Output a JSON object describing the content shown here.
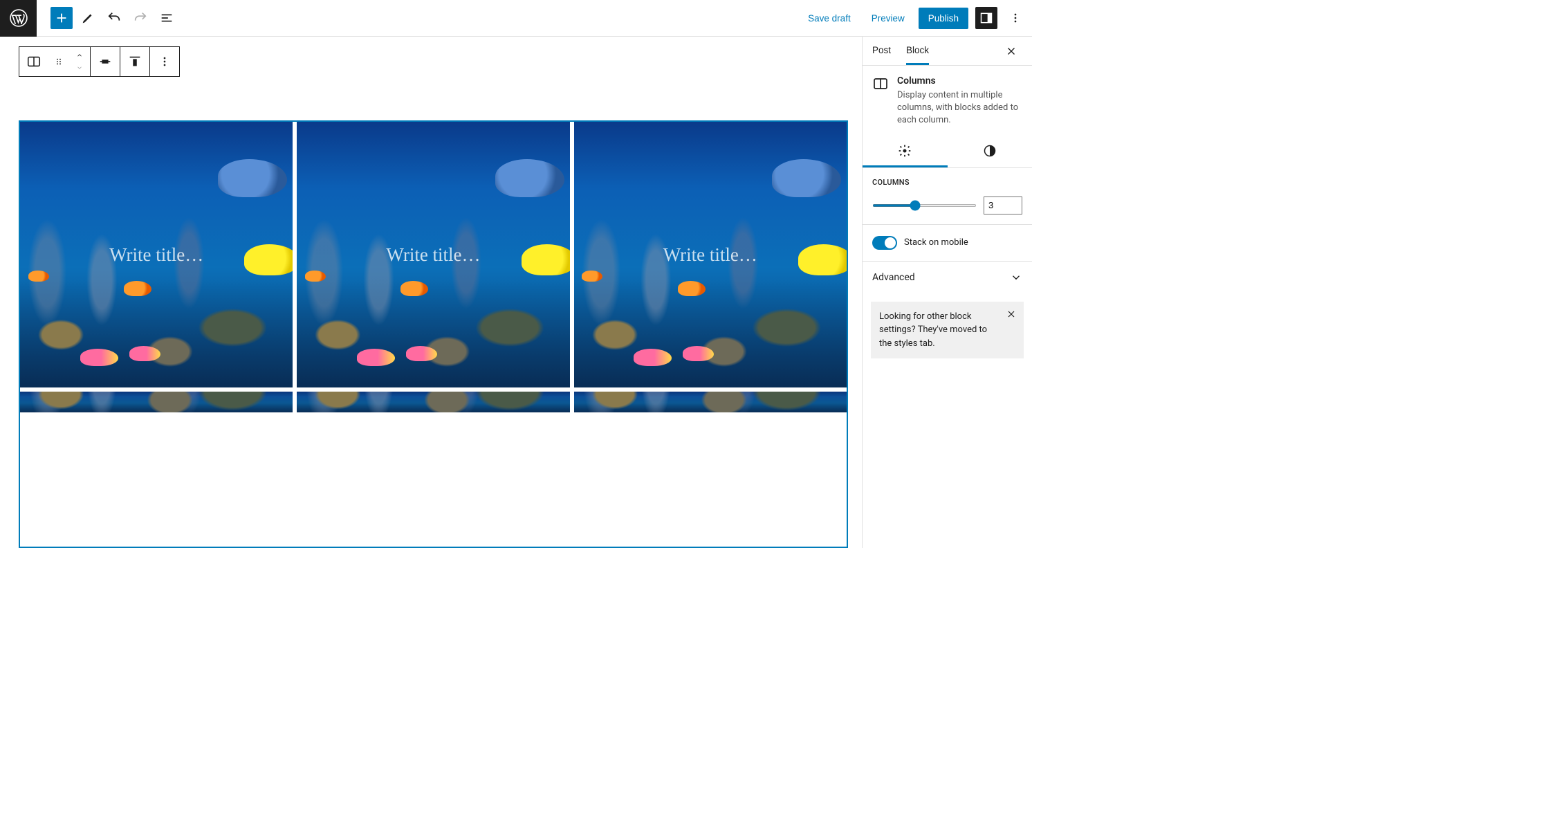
{
  "header": {
    "save_draft": "Save draft",
    "preview": "Preview",
    "publish": "Publish"
  },
  "sidebar": {
    "tabs": {
      "post": "Post",
      "block": "Block"
    },
    "block_card": {
      "title": "Columns",
      "desc": "Display content in multiple columns, with blocks added to each column."
    },
    "columns_panel": {
      "label": "Columns",
      "value": "3",
      "min": "1",
      "max": "6"
    },
    "stack_label": "Stack on mobile",
    "advanced_label": "Advanced",
    "notice": "Looking for other block settings? They've moved to the styles tab."
  },
  "canvas": {
    "cover_placeholder": "Write title…"
  }
}
